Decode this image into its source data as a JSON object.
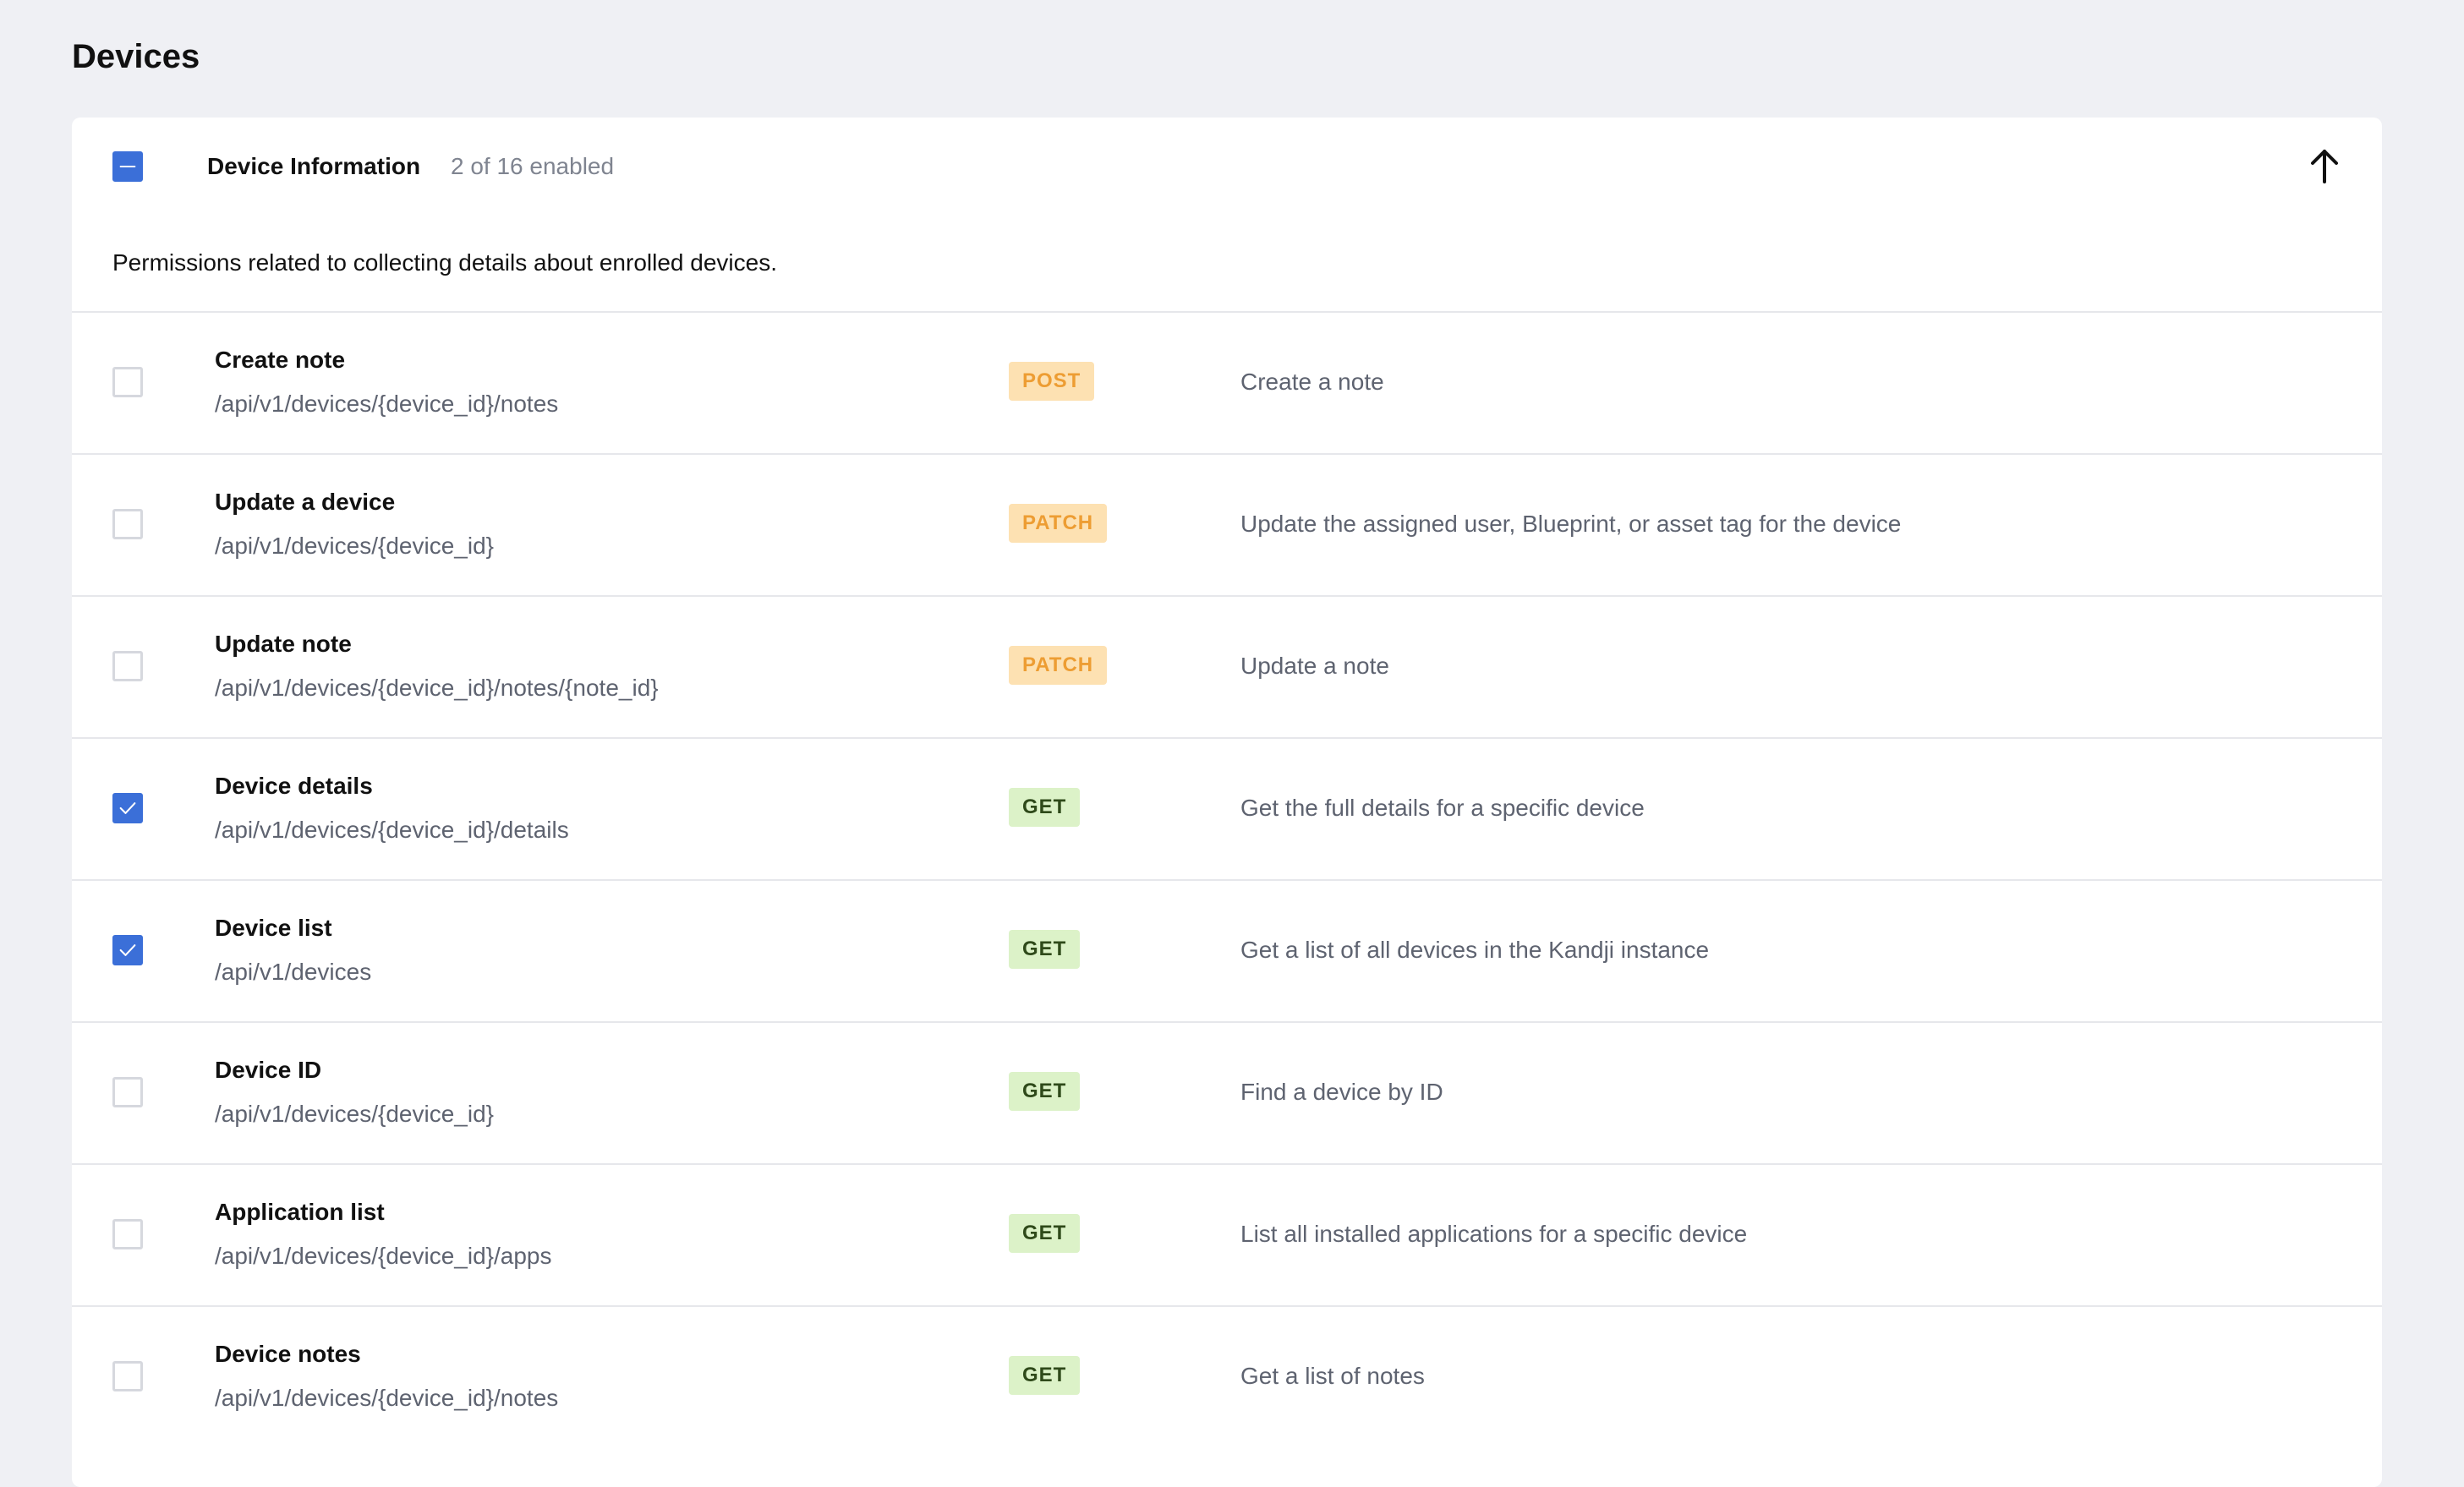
{
  "page": {
    "title": "Devices"
  },
  "section": {
    "title": "Device Information",
    "count_text": "2 of 16 enabled",
    "description": "Permissions related to collecting details about enrolled devices.",
    "select_state": "partial",
    "collapse_icon": "arrow-up-icon"
  },
  "colors": {
    "accent": "#3b6fd8",
    "background": "#eff0f4",
    "badge_write_bg": "#fde1b2",
    "badge_write_text": "#ed9d33",
    "badge_get_bg": "#dcf2c8",
    "badge_get_text": "#2f4a1a"
  },
  "permissions": [
    {
      "name": "Create note",
      "path": "/api/v1/devices/{device_id}/notes",
      "method": "POST",
      "description": "Create a note",
      "checked": false
    },
    {
      "name": "Update a device",
      "path": "/api/v1/devices/{device_id}",
      "method": "PATCH",
      "description": "Update the assigned user, Blueprint, or asset tag for the device",
      "checked": false
    },
    {
      "name": "Update note",
      "path": "/api/v1/devices/{device_id}/notes/{note_id}",
      "method": "PATCH",
      "description": "Update a note",
      "checked": false
    },
    {
      "name": "Device details",
      "path": "/api/v1/devices/{device_id}/details",
      "method": "GET",
      "description": "Get the full details for a specific device",
      "checked": true
    },
    {
      "name": "Device list",
      "path": "/api/v1/devices",
      "method": "GET",
      "description": "Get a list of all devices in the Kandji instance",
      "checked": true
    },
    {
      "name": "Device ID",
      "path": "/api/v1/devices/{device_id}",
      "method": "GET",
      "description": "Find a device by ID",
      "checked": false
    },
    {
      "name": "Application list",
      "path": "/api/v1/devices/{device_id}/apps",
      "method": "GET",
      "description": "List all installed applications for a specific device",
      "checked": false
    },
    {
      "name": "Device notes",
      "path": "/api/v1/devices/{device_id}/notes",
      "method": "GET",
      "description": "Get a list of notes",
      "checked": false
    }
  ]
}
